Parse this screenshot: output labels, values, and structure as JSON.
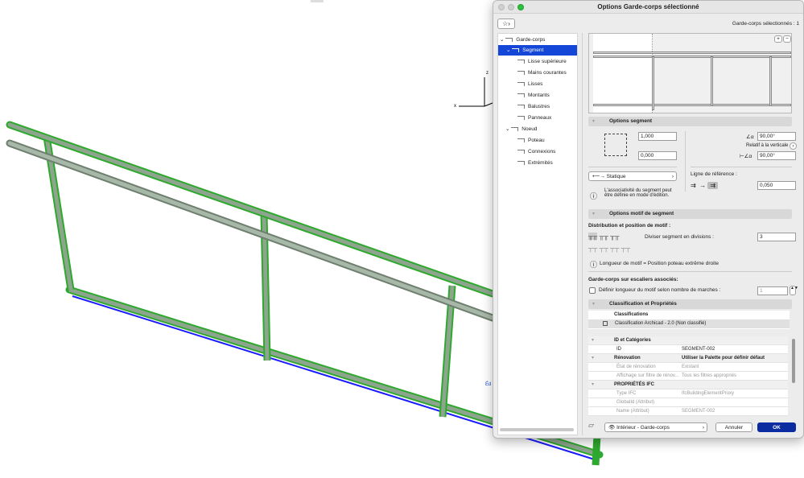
{
  "canvas": {
    "axis_z": "z",
    "axis_x": "x",
    "edge_label": "Éd"
  },
  "dialog": {
    "title": "Options Garde-corps sélectionné",
    "selected_count": "Garde-corps sélectionnés : 1",
    "tree": [
      {
        "label": "Garde-corps",
        "level": 0,
        "expanded": true
      },
      {
        "label": "Segment",
        "level": 1,
        "expanded": true,
        "selected": true
      },
      {
        "label": "Lisse supérieure",
        "level": 2
      },
      {
        "label": "Mains courantes",
        "level": 2
      },
      {
        "label": "Lisses",
        "level": 2
      },
      {
        "label": "Montants",
        "level": 2
      },
      {
        "label": "Balustres",
        "level": 2
      },
      {
        "label": "Panneaux",
        "level": 2
      },
      {
        "label": "Noeud",
        "level": 1,
        "expanded": true
      },
      {
        "label": "Poteau",
        "level": 2
      },
      {
        "label": "Connexions",
        "level": 2
      },
      {
        "label": "Extrémités",
        "level": 2
      }
    ],
    "preview": {
      "zoom_in": "+",
      "zoom_out": "−"
    },
    "segment_options": {
      "title": "Options segment",
      "height": "1,000",
      "offset": "0,000",
      "angle1": "90,00°",
      "relative_label": "Relatif à la verticale",
      "angle2": "90,00°",
      "mode": "Statique",
      "info": "L'associativité du segment peut être définie en mode d'édition.",
      "ref_line_label": "Ligne de référence :",
      "ref_offset": "0,050"
    },
    "pattern_options": {
      "title": "Options motif de segment",
      "distribution_label": "Distribution et position de motif :",
      "divisions_label": "Diviser segment en divisions :",
      "divisions": "3",
      "info": "Longueur de motif = Position poteau extrême droite",
      "stairs_label": "Garde-corps sur escaliers associés:",
      "checkbox_label": "Définir longueur du motif selon nombre de marches :",
      "steps": "1"
    },
    "classification": {
      "title": "Classification et Propriétés",
      "header": "Classifications",
      "item": "Classification Archicad - 2.0  (Non classifié)",
      "rows": [
        {
          "type": "group",
          "name": "ID et Catégories",
          "value": ""
        },
        {
          "type": "row",
          "name": "ID",
          "value": "SEGMENT-002"
        },
        {
          "type": "group",
          "name": "Rénovation",
          "value": "Utiliser la Palette pour définir défaut"
        },
        {
          "type": "dim",
          "name": "État de rénovation",
          "value": "Existant"
        },
        {
          "type": "dim",
          "name": "Affichage sur filtre de rénov...",
          "value": "Tous les filtres appropriés"
        },
        {
          "type": "group",
          "name": "PROPRIÉTÉS IFC",
          "value": ""
        },
        {
          "type": "dim",
          "name": "Type IFC",
          "value": "IfcBuildingElementProxy"
        },
        {
          "type": "dim",
          "name": "GlobalId (Attribut)",
          "value": ""
        },
        {
          "type": "dim",
          "name": "Name (Attribut)",
          "value": "SEGMENT-002"
        }
      ]
    },
    "footer": {
      "layer": "Intérieur - Garde-corps",
      "cancel": "Annuler",
      "ok": "OK"
    }
  }
}
